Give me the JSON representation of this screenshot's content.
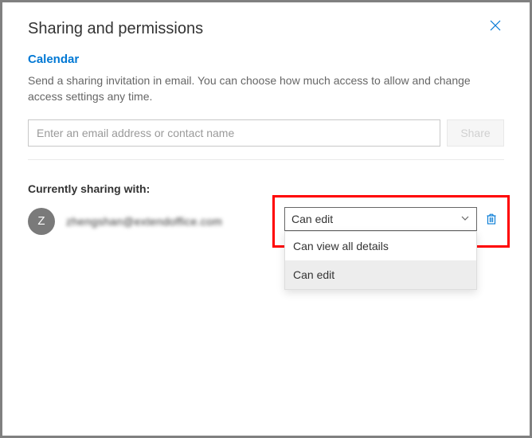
{
  "header": {
    "title": "Sharing and permissions"
  },
  "calendar": {
    "name": "Calendar",
    "description": "Send a sharing invitation in email. You can choose how much access to allow and change access settings any time."
  },
  "input": {
    "placeholder": "Enter an email address or contact name",
    "share_label": "Share"
  },
  "sharing": {
    "label": "Currently sharing with:",
    "entries": [
      {
        "initial": "Z",
        "display": "zhengshan@extendoffice.com",
        "permission_selected": "Can edit",
        "permission_options": [
          "Can view all details",
          "Can edit"
        ]
      }
    ]
  }
}
